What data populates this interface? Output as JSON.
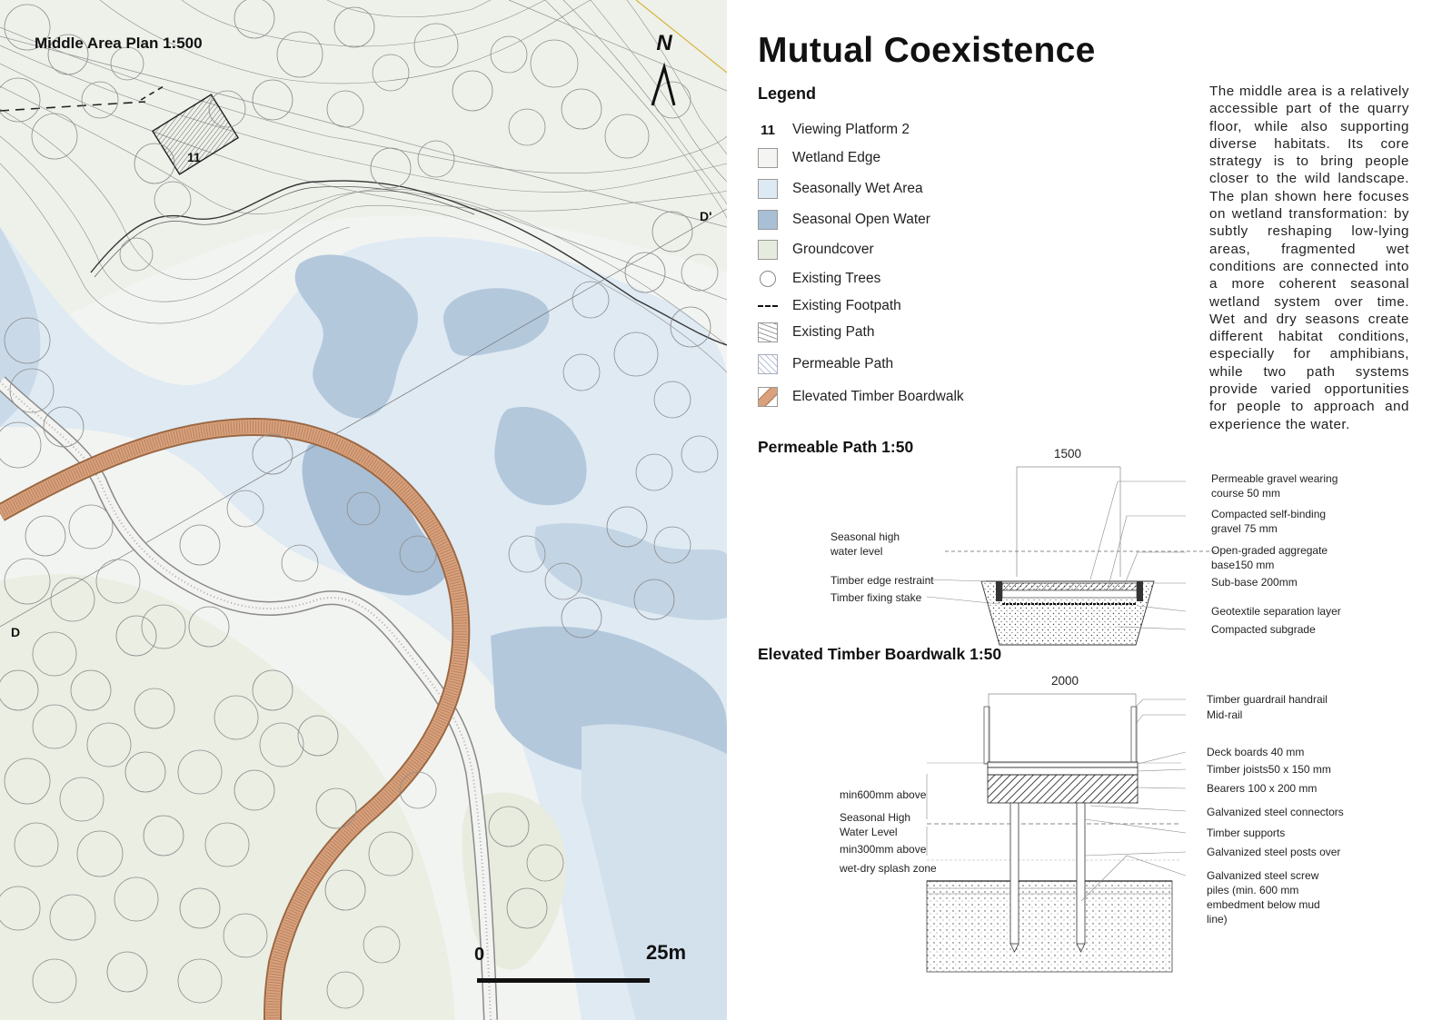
{
  "plan": {
    "title": "Middle Area Plan 1:500",
    "north": "N",
    "platform_number": "11",
    "section_start": "D",
    "section_end": "D'",
    "scale_zero": "0",
    "scale_end": "25m"
  },
  "title": "Mutual Coexistence",
  "legend": {
    "title": "Legend",
    "items": [
      {
        "symbol": "11",
        "label": "Viewing Platform 2"
      },
      {
        "symbol": "wetland-edge-swatch",
        "label": "Wetland Edge"
      },
      {
        "symbol": "seasonally-wet-swatch",
        "label": "Seasonally Wet Area"
      },
      {
        "symbol": "open-water-swatch",
        "label": "Seasonal Open Water"
      },
      {
        "symbol": "groundcover-swatch",
        "label": "Groundcover"
      },
      {
        "symbol": "tree-circle-icon",
        "label": "Existing Trees"
      },
      {
        "symbol": "dashed-line-icon",
        "label": "Existing Footpath"
      },
      {
        "symbol": "existing-path-swatch",
        "label": "Existing Path"
      },
      {
        "symbol": "permeable-path-swatch",
        "label": "Permeable Path"
      },
      {
        "symbol": "boardwalk-swatch",
        "label": "Elevated Timber Boardwalk"
      }
    ]
  },
  "description": "The middle area is a relatively accessible part of the quarry floor, while also supporting diverse habitats. Its core strategy is to bring people closer to the wild landscape. The plan shown here focuses on wetland transformation: by subtly reshaping low-lying areas, fragmented wet conditions are connected into a more coherent seasonal wetland system over time. Wet and dry seasons create different habitat conditions, especially for amphibians, while two path systems provide varied opportunities for people to approach and experience the water.",
  "permeable_path": {
    "title": "Permeable Path 1:50",
    "width": "1500",
    "left_notes": [
      "Seasonal high water level",
      "Timber edge restraint",
      "Timber fixing stake"
    ],
    "right_notes": [
      "Permeable gravel wearing course 50 mm",
      "Compacted self-binding gravel 75 mm",
      "Open-graded aggregate base150 mm",
      "Sub-base 200mm",
      "Geotextile separation layer",
      "Compacted subgrade"
    ]
  },
  "boardwalk": {
    "title": "Elevated Timber Boardwalk 1:50",
    "width": "2000",
    "left_notes": [
      "min600mm above",
      "Seasonal High Water Level",
      "min300mm above",
      "wet-dry splash zone"
    ],
    "right_notes": [
      "Timber guardrail handrail",
      "Mid-rail",
      "Deck boards 40 mm",
      "Timber joists50 x 150 mm",
      "Bearers 100 x 200 mm",
      "Galvanized steel connectors",
      "Timber supports",
      "Galvanized steel posts over",
      "Galvanized steel screw piles (min. 600 mm embedment below mud line)"
    ]
  },
  "colors": {
    "wetland_edge": "#f4f5f2",
    "seasonally_wet": "#dde9f3",
    "open_water": "#a9bfd5",
    "groundcover": "#e6ebdf",
    "boardwalk": "#d9a27c",
    "boardwalk_edge": "#a8724f"
  }
}
